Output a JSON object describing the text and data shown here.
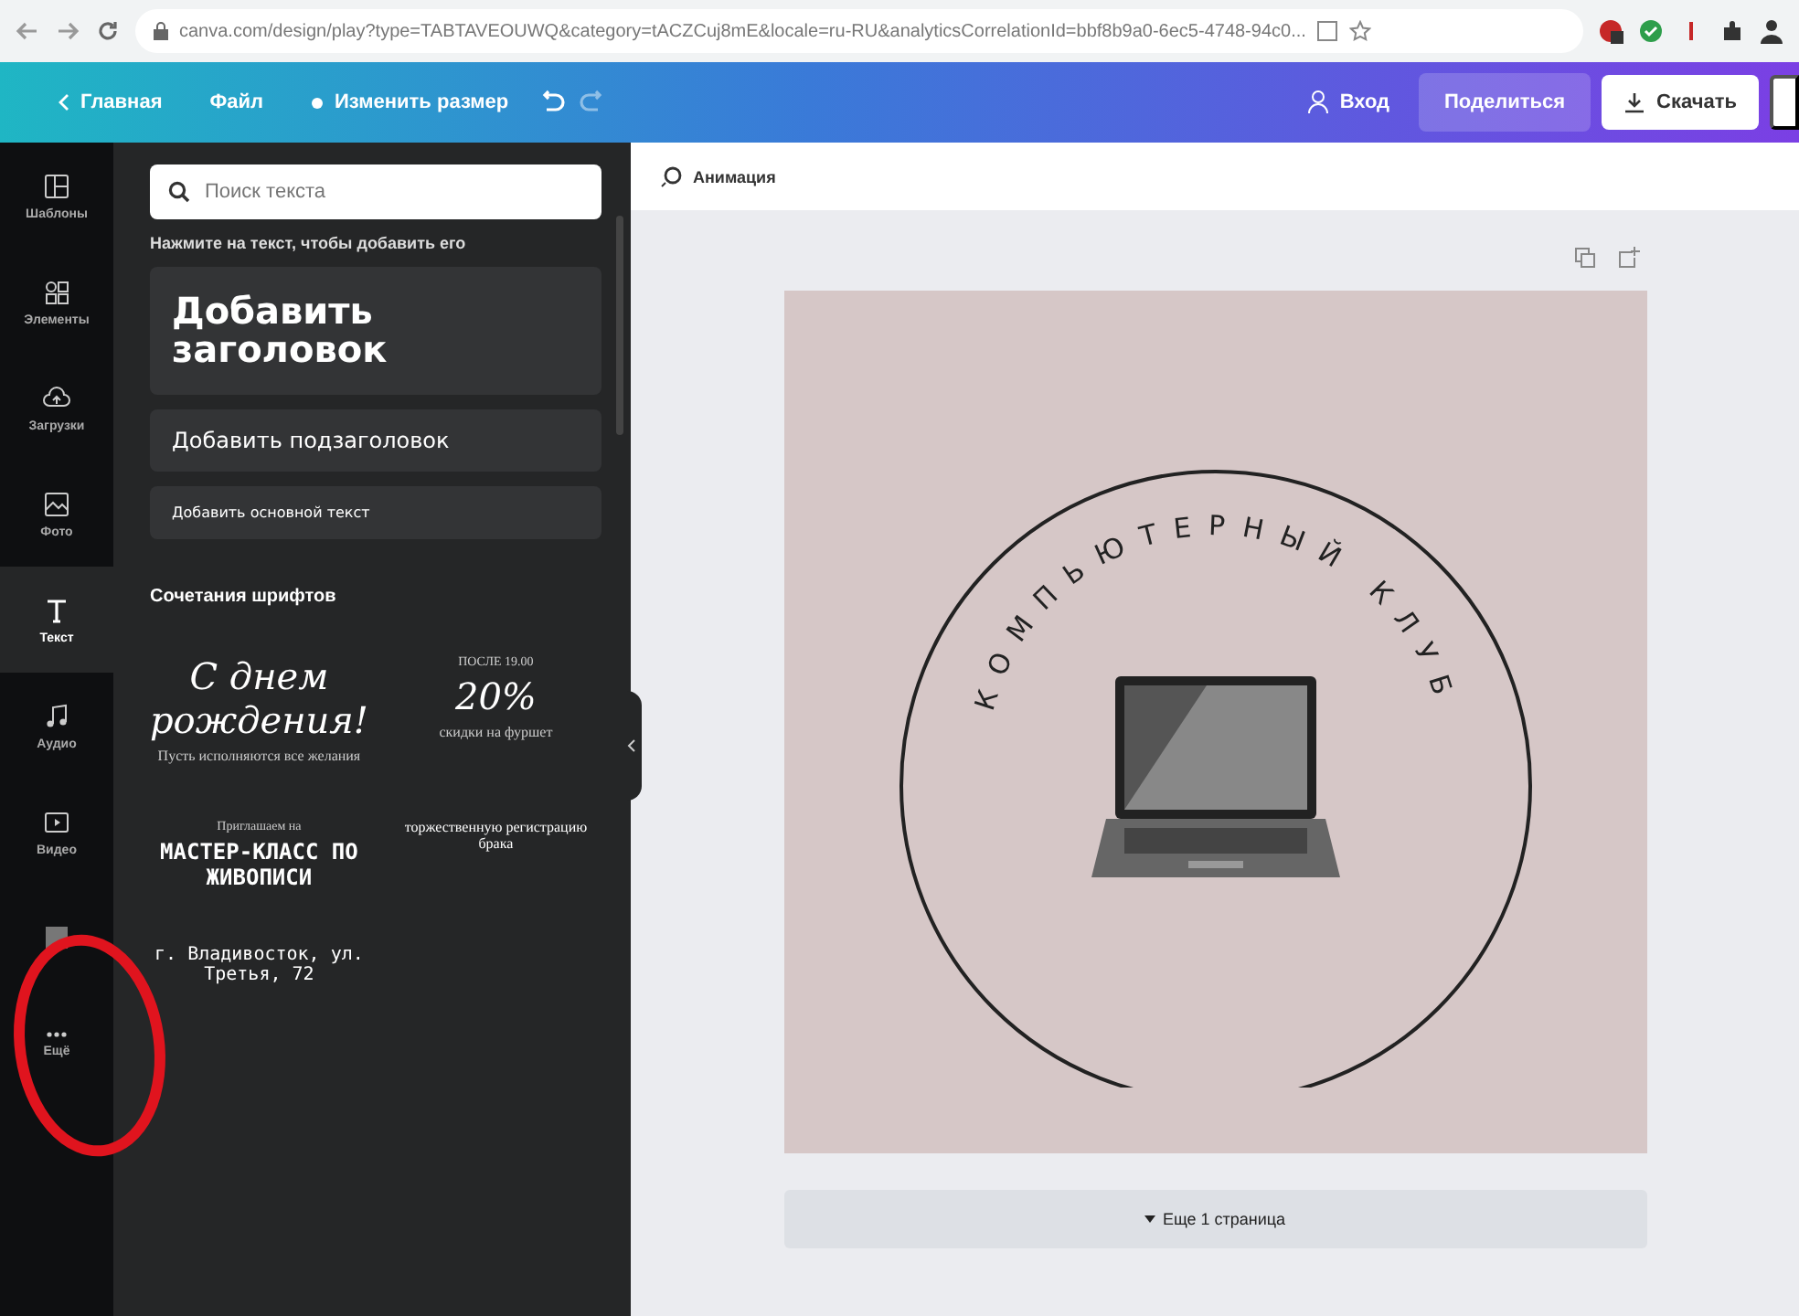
{
  "browser": {
    "url": "canva.com/design/play?type=TABTAVEOUWQ&category=tACZCuj8mE&locale=ru-RU&analyticsCorrelationId=bbf8b9a0-6ec5-4748-94c0..."
  },
  "topbar": {
    "home": "Главная",
    "file": "Файл",
    "resize": "Изменить размер",
    "login": "Вход",
    "share": "Поделиться",
    "download": "Скачать"
  },
  "rail": [
    {
      "kind": "templates",
      "label": "Шаблоны",
      "selected": false
    },
    {
      "kind": "elements",
      "label": "Элементы",
      "selected": false
    },
    {
      "kind": "uploads",
      "label": "Загрузки",
      "selected": false
    },
    {
      "kind": "photos",
      "label": "Фото",
      "selected": false
    },
    {
      "kind": "text",
      "label": "Текст",
      "selected": true
    },
    {
      "kind": "audio",
      "label": "Аудио",
      "selected": false
    },
    {
      "kind": "video",
      "label": "Видео",
      "selected": false
    },
    {
      "kind": "background",
      "selected": false
    },
    {
      "kind": "more",
      "label": "Ещё",
      "selected": false
    }
  ],
  "panel": {
    "search_placeholder": "Поиск текста",
    "hint": "Нажмите на текст, чтобы добавить его",
    "heading": "Добавить заголовок",
    "subheading": "Добавить подзаголовок",
    "body": "Добавить основной текст",
    "combos_title": "Сочетания шрифтов",
    "combos": [
      {
        "lines": [
          {
            "kind": "script",
            "text": "С днем рождения!"
          },
          {
            "kind": "serif",
            "text": "Пусть исполняются все желания"
          }
        ]
      },
      {
        "lines": [
          {
            "kind": "small",
            "text": "ПОСЛЕ 19.00"
          },
          {
            "kind": "script",
            "text": "20%"
          },
          {
            "kind": "serif",
            "text": "скидки на фуршет"
          }
        ]
      },
      {
        "lines": [
          {
            "kind": "small",
            "text": "Приглашаем на"
          },
          {
            "kind": "display",
            "text": "МАСТЕР-КЛАСС ПО ЖИВОПИСИ"
          }
        ]
      },
      {
        "lines": [
          {
            "kind": "serif",
            "text": "торжественную регистрацию брака"
          }
        ]
      },
      {
        "lines": [
          {
            "kind": "mono",
            "text": "г. Владивосток, ул. Третья, 72"
          }
        ]
      }
    ]
  },
  "editor": {
    "animation": "Анимация",
    "design_text": "КОМПЬЮТЕРНЫЙ КЛУБ",
    "more_pages": "Еще 1 страница"
  },
  "annotation": {
    "kind": "ellipse"
  }
}
